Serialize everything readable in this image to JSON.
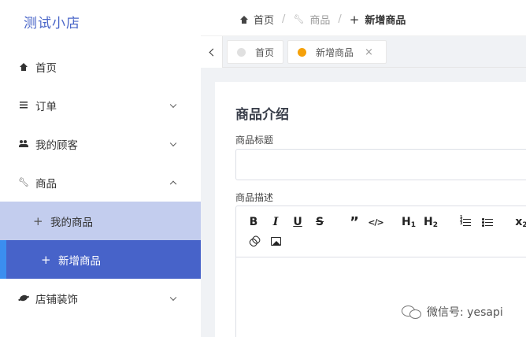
{
  "app": {
    "logo_text": "测试小店"
  },
  "sidebar": {
    "items": [
      {
        "label": "首页",
        "icon": "home-icon"
      },
      {
        "label": "订单",
        "icon": "list-icon",
        "expanded": false
      },
      {
        "label": "我的顾客",
        "icon": "people-icon",
        "expanded": false
      },
      {
        "label": "商品",
        "icon": "wrench-icon",
        "expanded": true,
        "children": [
          {
            "label": "我的商品",
            "icon": "plus-icon"
          },
          {
            "label": "新增商品",
            "icon": "plus-icon",
            "active": true
          }
        ]
      },
      {
        "label": "店铺装饰",
        "icon": "planet-icon",
        "expanded": false
      }
    ]
  },
  "breadcrumb": {
    "items": [
      "首页",
      "商品",
      "新增商品"
    ],
    "separator": "/"
  },
  "tabs": [
    {
      "label": "首页",
      "dot_color": "#e0e0e0"
    },
    {
      "label": "新增商品",
      "dot_color": "#f5a10a",
      "closable": true,
      "close_glyph": "×"
    }
  ],
  "form": {
    "section_title": "商品介绍",
    "title_label": "商品标题",
    "title_value": "",
    "desc_label": "商品描述",
    "editor_toolbar": [
      "bold",
      "italic",
      "underline",
      "strike",
      "blockquote",
      "code-block",
      "h1",
      "h2",
      "ordered-list",
      "bullet-list",
      "subscript",
      "link",
      "image"
    ]
  },
  "watermark": {
    "text": "微信号: yesapi"
  },
  "colors": {
    "brand": "#4a66c8",
    "active_bg": "#4763c9",
    "sub_bg": "#c3cdee",
    "active_bar": "#3b8ef0"
  }
}
